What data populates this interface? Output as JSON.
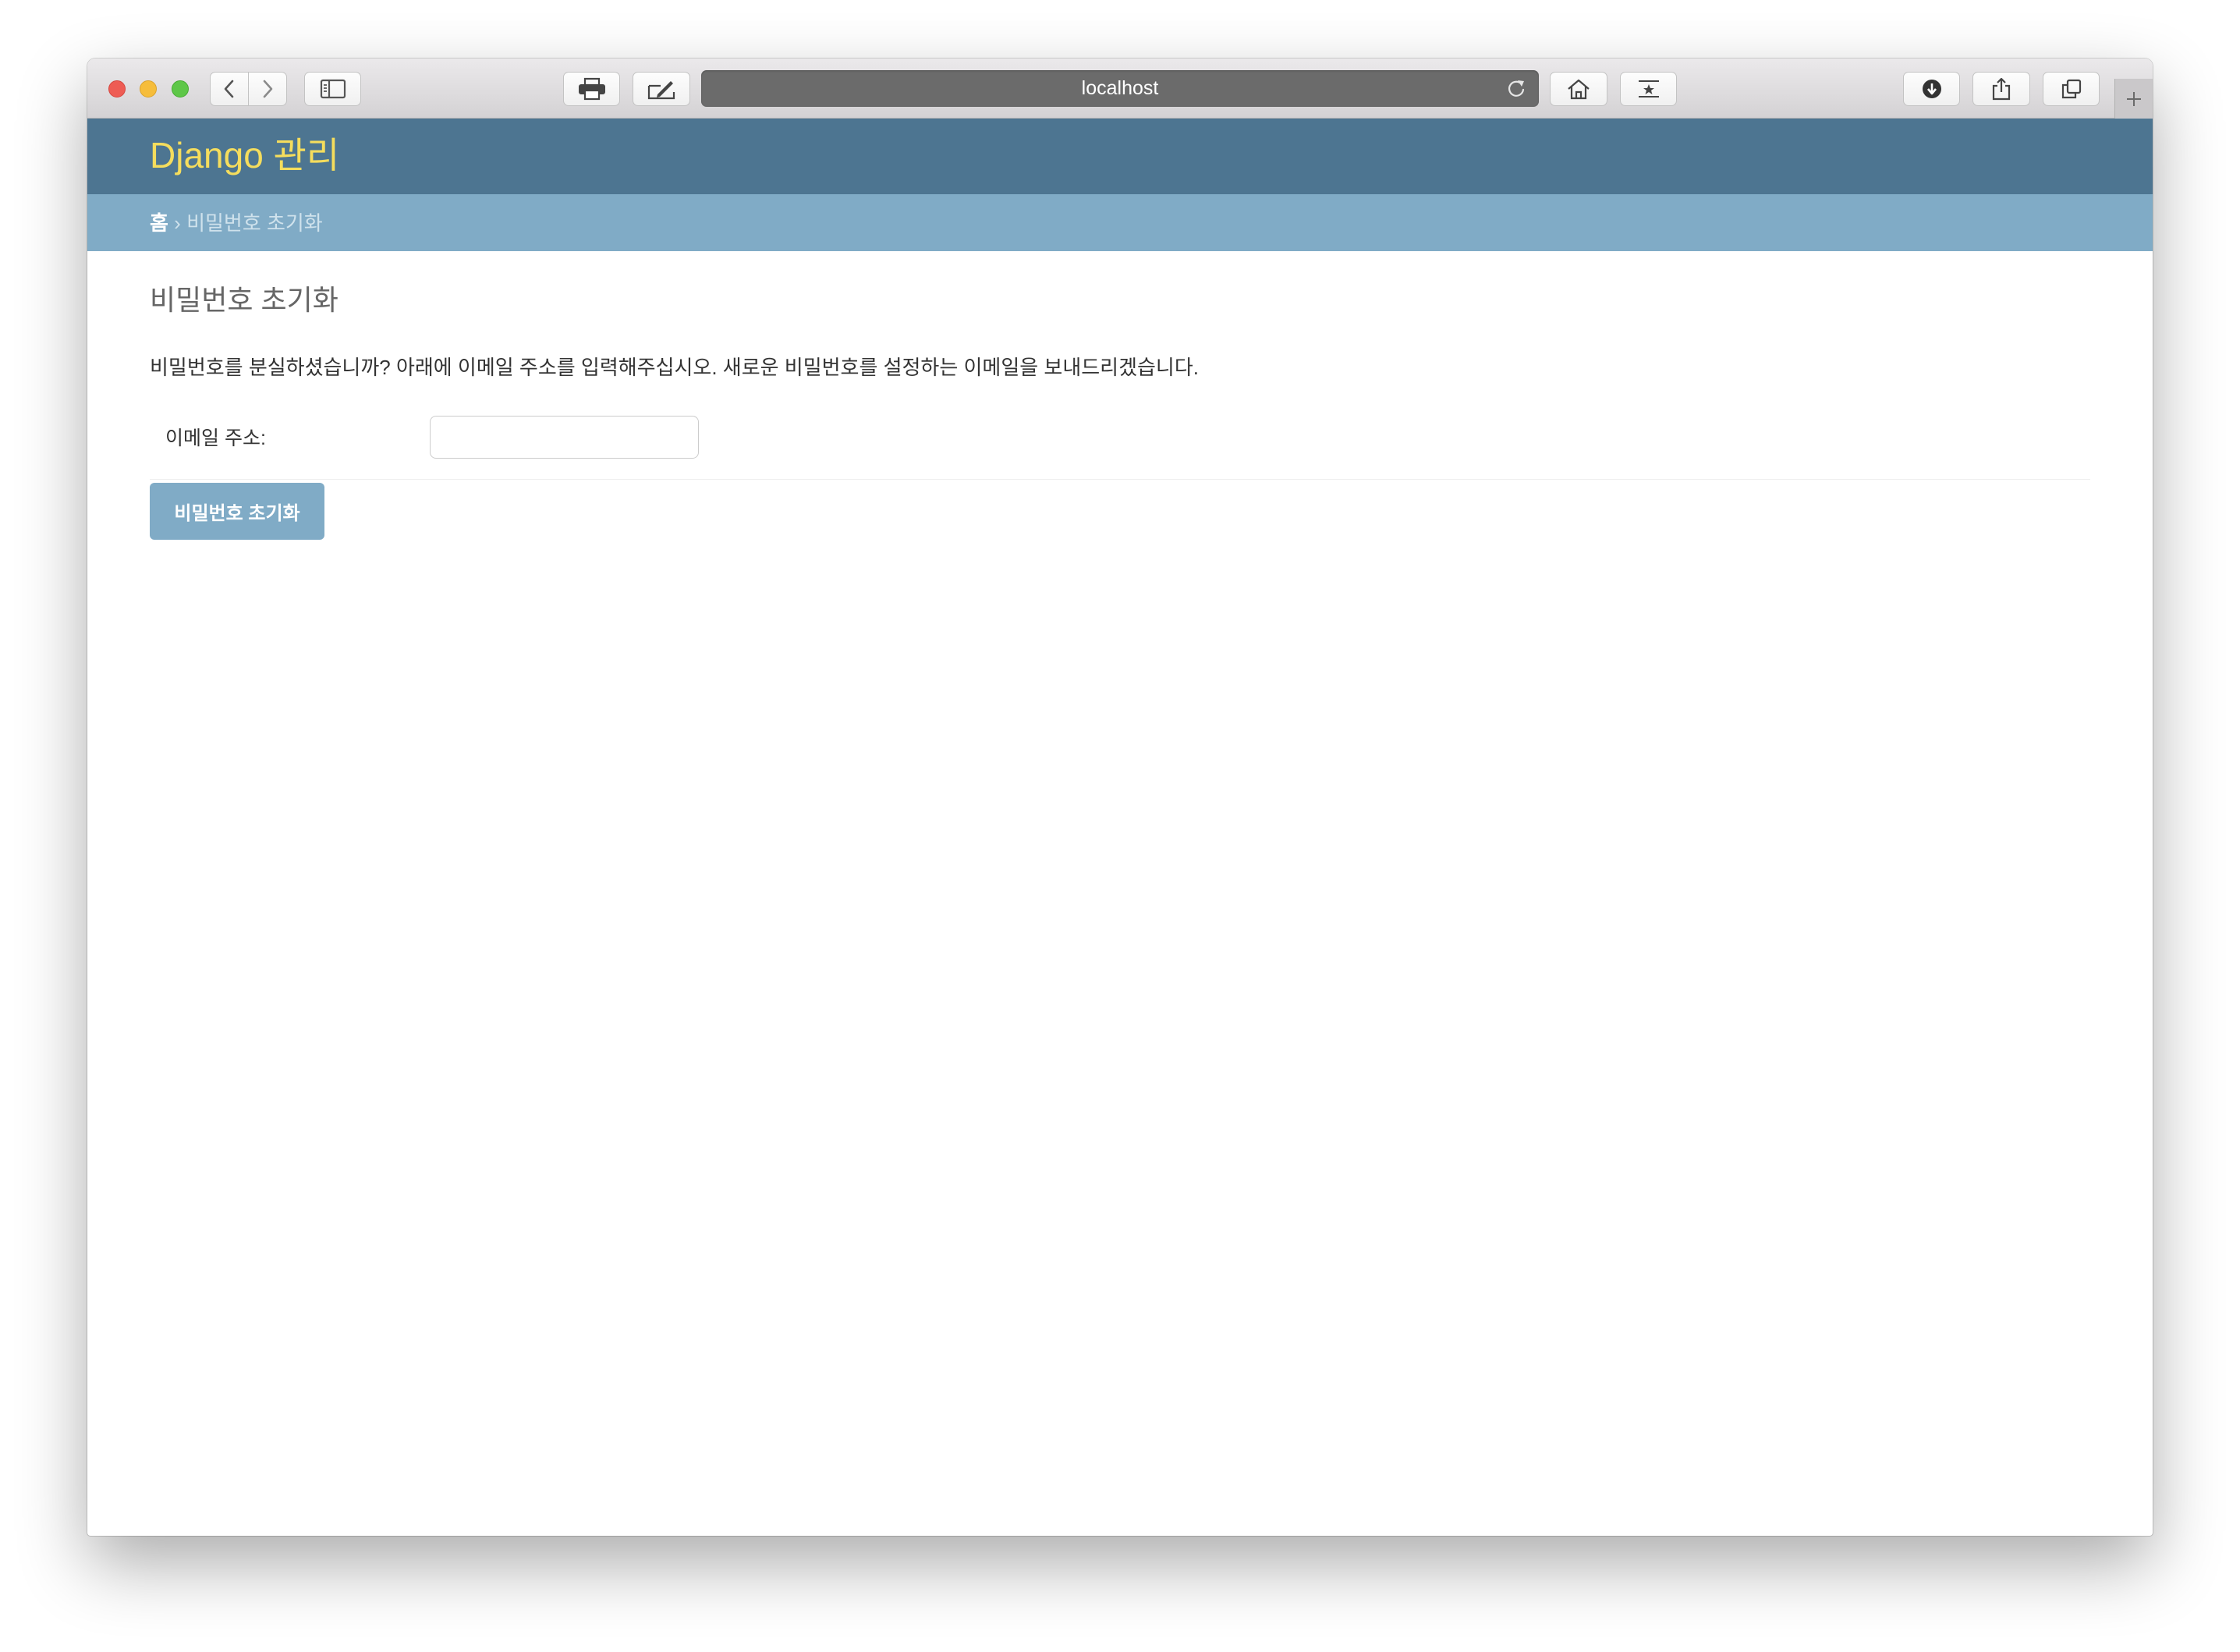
{
  "browser": {
    "address_bar": {
      "url": "localhost"
    }
  },
  "header": {
    "branding": "Django 관리"
  },
  "breadcrumbs": {
    "home": "홈",
    "separator": "›",
    "current": "비밀번호 초기화"
  },
  "content": {
    "title": "비밀번호 초기화",
    "intro": "비밀번호를 분실하셨습니까? 아래에 이메일 주소를 입력해주십시오. 새로운 비밀번호를 설정하는 이메일을 보내드리겠습니다.",
    "form": {
      "email_label": "이메일 주소:",
      "email_value": "",
      "submit_label": "비밀번호 초기화"
    }
  },
  "colors": {
    "header_bg": "#4d7591",
    "branding": "#f5dd5d",
    "breadcrumbs_bg": "#80abc6",
    "breadcrumb_link": "#ffffff",
    "breadcrumb_text": "#cfe2ec",
    "button_bg": "#80abc6",
    "title_text": "#666666",
    "body_text": "#333333",
    "url_bar_bg": "#6b6b6b"
  },
  "icons": {
    "back": "chevron-left-icon",
    "forward": "chevron-right-icon",
    "sidebar": "sidebar-icon",
    "print": "printer-icon",
    "markup": "markup-pen-icon",
    "reload": "reload-icon",
    "home": "home-icon",
    "top_sites": "star-icon",
    "download": "download-icon",
    "share": "share-icon",
    "tabs": "tabs-overview-icon",
    "new_tab": "plus-icon"
  }
}
